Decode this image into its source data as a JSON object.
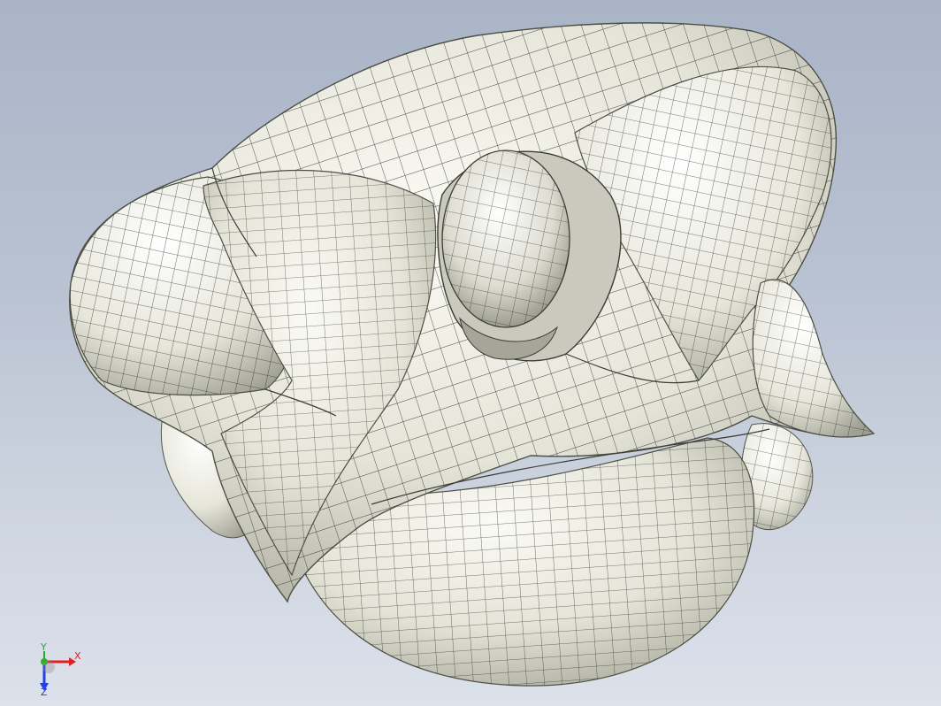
{
  "viewport": {
    "background_top": "#a9b4c7",
    "background_bottom": "#dce1ea"
  },
  "model": {
    "surface_color": "#ecece2",
    "highlight_color": "#fbfbf5",
    "shadow_color": "#9a9c8c",
    "mesh_line_color": "#1a1a1a"
  },
  "triad": {
    "x_label": "X",
    "y_label": "Y",
    "z_label": "Z",
    "x_color": "#e02020",
    "y_color": "#20b020",
    "z_color": "#2040e0"
  }
}
